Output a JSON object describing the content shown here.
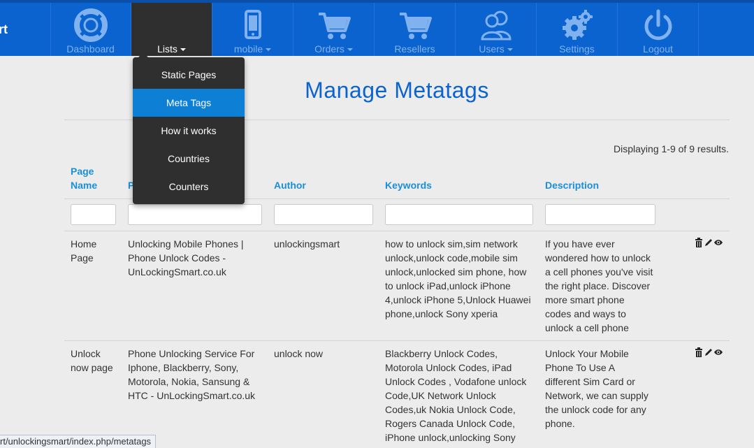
{
  "brand": {
    "text": "rt"
  },
  "nav": [
    {
      "label": "Dashboard",
      "icon": "lifebuoy-icon",
      "caret": false
    },
    {
      "label": "Lists",
      "icon": "",
      "caret": true,
      "active": true
    },
    {
      "label": "mobile",
      "icon": "mobile-phone-icon",
      "caret": true
    },
    {
      "label": "Orders",
      "icon": "cart-icon",
      "caret": true
    },
    {
      "label": "Resellers",
      "icon": "cart-icon",
      "caret": false
    },
    {
      "label": "Users",
      "icon": "users-icon",
      "caret": true
    },
    {
      "label": "Settings",
      "icon": "gear-icon",
      "caret": false
    },
    {
      "label": "Logout",
      "icon": "power-icon",
      "caret": false
    }
  ],
  "dropdown": {
    "items": [
      {
        "label": "Static Pages"
      },
      {
        "label": "Meta Tags",
        "active": true
      },
      {
        "label": "How it works"
      },
      {
        "label": "Countries"
      },
      {
        "label": "Counters"
      }
    ]
  },
  "page": {
    "title": "Manage Metatags",
    "summary": "Displaying 1-9 of 9 results."
  },
  "table": {
    "headers": {
      "page_name_1": "Page",
      "page_name_2": "Name",
      "title_partial": "P",
      "author": "Author",
      "keywords": "Keywords",
      "description": "Description"
    },
    "rows": [
      {
        "page_name": [
          "Home",
          "Page"
        ],
        "title": [
          "Unlocking Mobile Phones |",
          "Phone Unlock Codes -",
          "UnLockingSmart.co.uk"
        ],
        "author": [
          "unlockingsmart"
        ],
        "keywords": [
          "how to unlock sim,sim network",
          "unlock,unlock code,mobile sim",
          "unlock,unlocked sim phone, how",
          "to unlock iPad,unlock iPhone",
          "4,unlock iPhone 5,Unlock Huawei",
          "phone,unlock Sony xperia"
        ],
        "description": [
          "If you have ever",
          "wondered how to unlock",
          "a cell phones you've visit",
          "the right place. Discover",
          "more smart phone",
          "codes and ways to",
          "unlock a cell phone"
        ]
      },
      {
        "page_name": [
          "Unlock",
          "now page"
        ],
        "title": [
          "Phone Unlocking Service For",
          "Iphone, Blackberry, Sony,",
          "Motorola, Nokia, Sansung &",
          "HTC - UnLockingSmart.co.uk"
        ],
        "author": [
          "unlock now"
        ],
        "keywords": [
          "Blackberry Unlock Codes,",
          "Motorola Unlock Codes, iPad",
          "Unlock Codes , Vodafone unlock",
          "Code,UK Network Unlock",
          "Codes,uk Nokia Unlock Code,",
          "Rogers Canada Unlock Code,",
          "iPhone unlock,unlocking Sony"
        ],
        "description": [
          "Unlock Your Mobile",
          "Phone To Use A",
          "different Sim Card or",
          "Network, we can supply",
          "the unlock code for any",
          "phone."
        ]
      }
    ],
    "action_icons": [
      "trash-icon",
      "pencil-icon",
      "eye-icon"
    ]
  },
  "statusbar": {
    "url": "rt/unlockingsmart/index.php/metatags"
  },
  "colors": {
    "nav_bg": "#0b63d0",
    "active_nav": "#2f2f2f",
    "accent": "#0d7fd4",
    "header_text": "#1a8fd8"
  }
}
